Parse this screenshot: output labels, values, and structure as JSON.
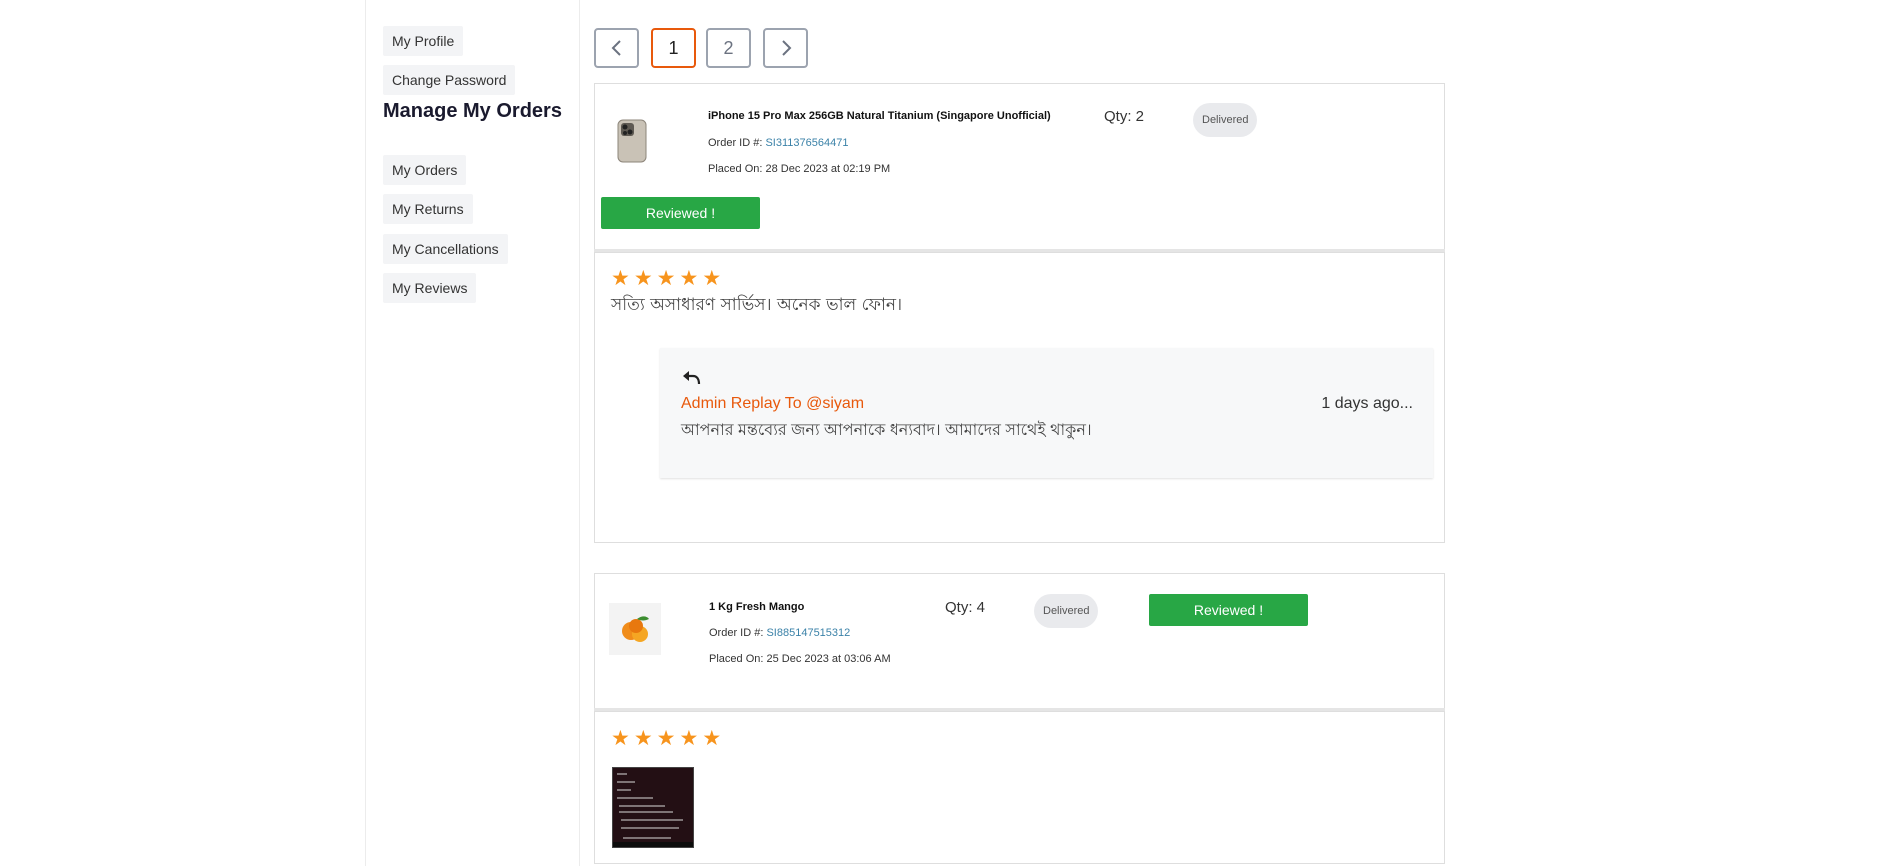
{
  "sidebar": {
    "account_items": [
      {
        "label": "My Profile"
      },
      {
        "label": "Change Password"
      }
    ],
    "heading": "Manage My Orders",
    "order_items": [
      {
        "label": "My Orders"
      },
      {
        "label": "My Returns"
      },
      {
        "label": "My Cancellations"
      },
      {
        "label": "My Reviews"
      }
    ]
  },
  "pagination": {
    "prev_icon": "chevron-left-icon",
    "pages": [
      "1",
      "2"
    ],
    "current_page": "1",
    "next_icon": "chevron-right-icon"
  },
  "colors": {
    "accent": "#e8590c",
    "success": "#28a745",
    "star": "#f7941d",
    "link": "#3b82a8"
  },
  "reviews": [
    {
      "product_name": "iPhone 15 Pro Max 256GB Natural Titanium (Singapore Unofficial)",
      "order_id_label": "Order ID #:",
      "order_id": "SI311376564471",
      "placed_on": "Placed On: 28 Dec 2023 at 02:19 PM",
      "qty": "Qty: 2",
      "status": "Delivered",
      "reviewed_label": "Reviewed !",
      "rating": 5,
      "comment": "সত্যি অসাধারণ সার্ভিস। অনেক ভাল ফোন।",
      "reply": {
        "icon": "reply-icon",
        "title": "Admin Replay To @siyam",
        "time_ago": "1 days ago...",
        "text": "আপনার মন্তব্যের জন্য আপনাকে ধন্যবাদ। আমাদের সাথেই থাকুন।"
      }
    },
    {
      "product_name": "1 Kg Fresh Mango",
      "order_id_label": "Order ID #:",
      "order_id": "SI885147515312",
      "placed_on": "Placed On: 25 Dec 2023 at 03:06 AM",
      "qty": "Qty: 4",
      "status": "Delivered",
      "reviewed_label": "Reviewed !",
      "rating": 5,
      "comment": ""
    }
  ]
}
